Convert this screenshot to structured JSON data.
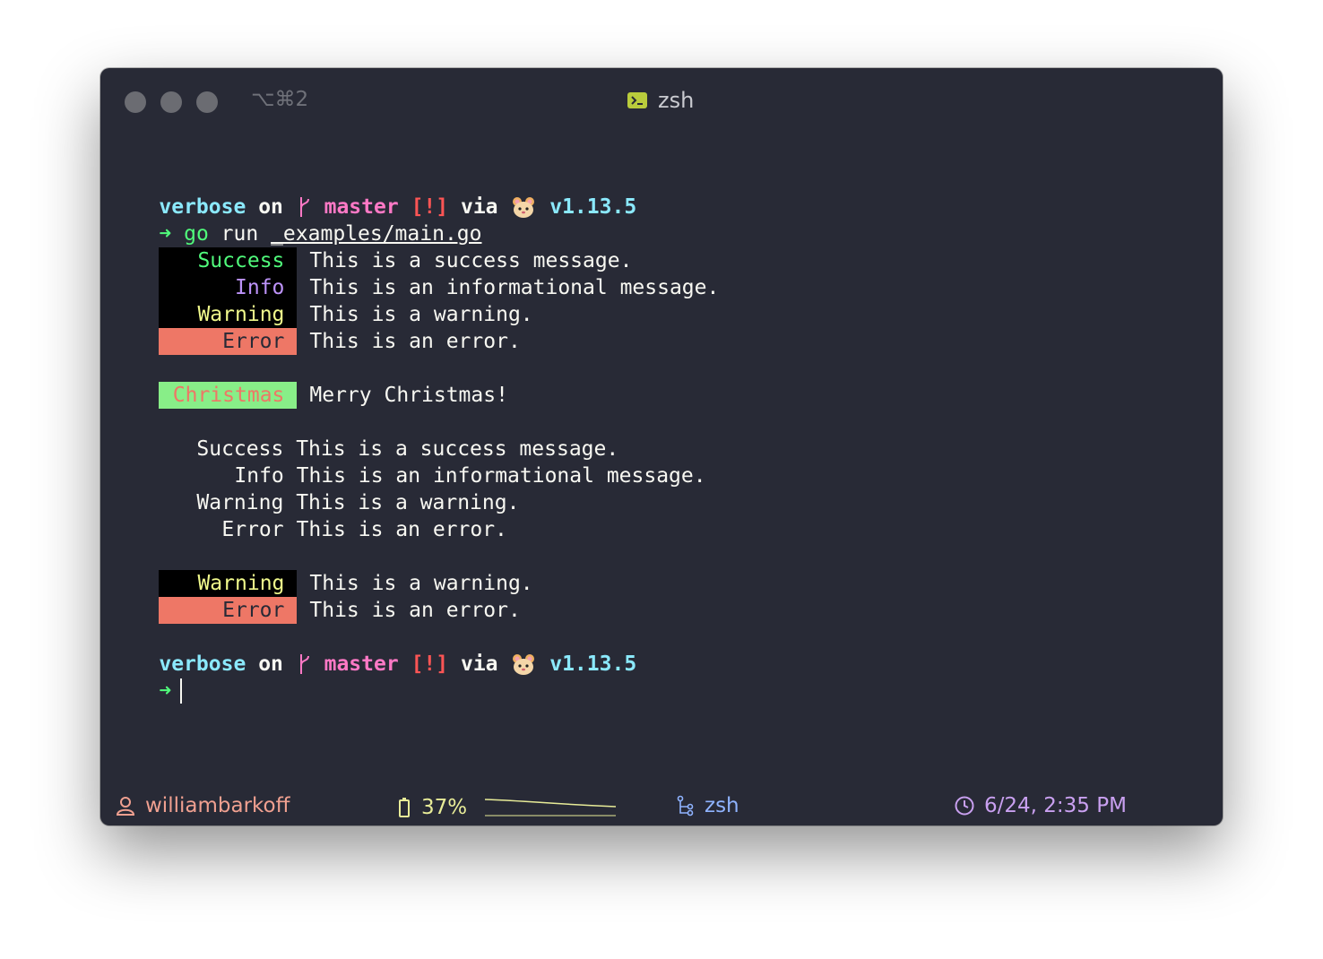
{
  "window": {
    "shortcut": "⌥⌘2",
    "title": "zsh"
  },
  "prompt": {
    "dir": "verbose",
    "on": "on",
    "branch": "master",
    "status": "[!]",
    "via": "via",
    "version": "v1.13.5",
    "arrow": "➜"
  },
  "command": {
    "cmd": "go",
    "args": "run",
    "path": "_examples/main.go"
  },
  "output": {
    "block1": [
      {
        "label": "Success",
        "text": "This is a success message."
      },
      {
        "label": "Info",
        "text": "This is an informational message."
      },
      {
        "label": "Warning",
        "text": "This is a warning."
      },
      {
        "label": "Error",
        "text": "This is an error."
      }
    ],
    "christmas": {
      "label": "Christmas",
      "text": "Merry Christmas!"
    },
    "block2": [
      {
        "label": "Success",
        "text": "This is a success message."
      },
      {
        "label": "Info",
        "text": "This is an informational message."
      },
      {
        "label": "Warning",
        "text": "This is a warning."
      },
      {
        "label": "Error",
        "text": "This is an error."
      }
    ],
    "block3": [
      {
        "label": "Warning",
        "text": "This is a warning."
      },
      {
        "label": "Error",
        "text": "This is an error."
      }
    ]
  },
  "statusbar": {
    "user": "williambarkoff",
    "battery": "37%",
    "shell": "zsh",
    "datetime": "6/24, 2:35 PM"
  },
  "colors": {
    "background": "#282a36",
    "error_bg": "#ee7766",
    "christmas_bg": "#88ee88",
    "christmas_fg": "#ee7766",
    "status_user": "#f0a090",
    "status_battery": "#e8ec98",
    "status_shell": "#8fb3ff",
    "status_time": "#c9a0f0"
  }
}
